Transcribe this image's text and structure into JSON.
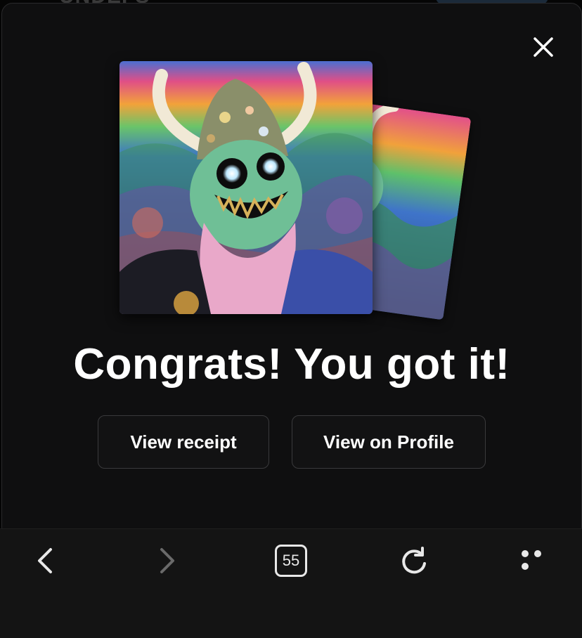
{
  "background_page": {
    "partial_title": "UNDEFS"
  },
  "modal": {
    "close_icon": "close-icon",
    "headline": "Congrats! You got it!",
    "buttons": {
      "view_receipt": "View receipt",
      "view_on_profile": "View on Profile"
    },
    "collectible": {
      "stack_count_visible": 2
    }
  },
  "browser_toolbar": {
    "back_icon": "chevron-left-icon",
    "forward_icon": "chevron-right-icon",
    "tab_count": "55",
    "reload_icon": "reload-icon",
    "more_icon": "more-dots-icon"
  },
  "colors": {
    "modal_bg": "#0f0f10",
    "button_border": "#3a3a3c",
    "toolbar_bg": "#141414",
    "text": "#ffffff"
  }
}
